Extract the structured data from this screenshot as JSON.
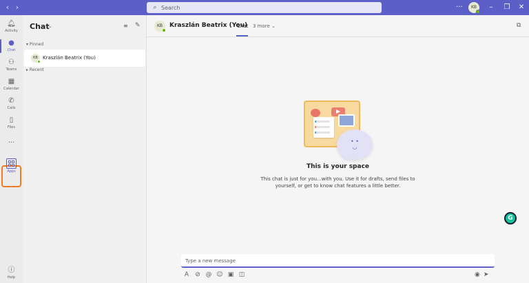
{
  "titlebar": {
    "back_icon": "chevron-left-icon",
    "forward_icon": "chevron-right-icon",
    "search_placeholder": "Search",
    "more_icon": "ellipsis-icon",
    "avatar_initials": "KB",
    "window_controls": [
      "minimize",
      "restore",
      "close"
    ]
  },
  "rail": {
    "items": [
      {
        "label": "Activity",
        "icon": "bell-icon"
      },
      {
        "label": "Chat",
        "icon": "chat-icon",
        "active": true
      },
      {
        "label": "Teams",
        "icon": "teams-icon"
      },
      {
        "label": "Calendar",
        "icon": "calendar-icon"
      },
      {
        "label": "Calls",
        "icon": "phone-icon"
      },
      {
        "label": "Files",
        "icon": "file-icon"
      },
      {
        "label": "Apps",
        "icon": "apps-icon",
        "highlighted": true
      },
      {
        "label": "Help",
        "icon": "help-icon"
      }
    ],
    "more_label": "..."
  },
  "chatlist": {
    "title": "Chat",
    "sections": {
      "pinned": "Pinned",
      "recent": "Recent"
    },
    "pinned_chats": [
      {
        "initials": "KB",
        "name": "Kraszlán Beatrix (You)"
      }
    ]
  },
  "main": {
    "header": {
      "initials": "KB",
      "name": "Kraszlán Beatrix (You)",
      "tab_active": "Chat",
      "tab_more": "3 more"
    },
    "empty_state": {
      "title": "This is your space",
      "description": "This chat is just for you...with you. Use it for drafts, send files to yourself, or get to know chat features a little better."
    },
    "composer": {
      "placeholder": "Type a new message"
    }
  },
  "colors": {
    "brand": "#5b5fc7",
    "highlight": "#f37b21",
    "presence": "#6bb700"
  }
}
